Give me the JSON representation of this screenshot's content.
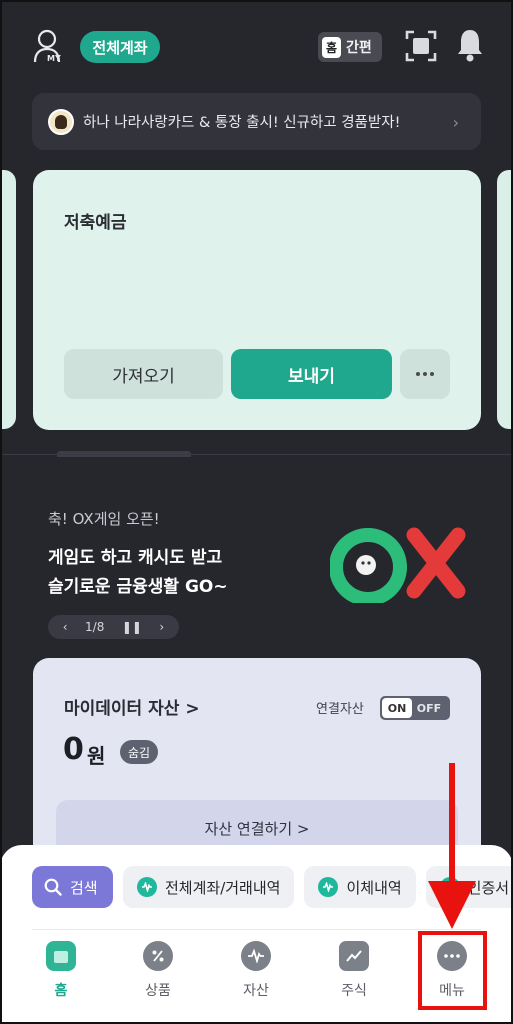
{
  "header": {
    "my_label": "MY",
    "all_accounts": "전체계좌",
    "easy_home_chip": "홈",
    "easy_label": "간편"
  },
  "banner": {
    "text": "하나 나라사랑카드 & 통장 출시! 신규하고 경품받자!"
  },
  "account_card": {
    "title": "저축예금",
    "get_label": "가져오기",
    "send_label": "보내기"
  },
  "promo": {
    "subtitle": "축! OX게임 오픈!",
    "line1": "게임도 하고 캐시도 받고",
    "line2": "슬기로운 금융생활 GO~",
    "page": "1/8"
  },
  "mydata": {
    "title": "마이데이터 자산 >",
    "linked_label": "연결자산",
    "toggle_on": "ON",
    "toggle_off": "OFF",
    "amount": "0",
    "unit": "원",
    "hide_label": "숨김",
    "connect_label": "자산 연결하기 >"
  },
  "quick_chips": [
    {
      "label": "검색"
    },
    {
      "label": "전체계좌/거래내역"
    },
    {
      "label": "이체내역"
    },
    {
      "label": "인증서"
    }
  ],
  "tabs": [
    {
      "label": "홈"
    },
    {
      "label": "상품"
    },
    {
      "label": "자산"
    },
    {
      "label": "주식"
    },
    {
      "label": "메뉴"
    }
  ],
  "colors": {
    "background": "#26262d",
    "accent": "#1fa88e",
    "annotation_red": "#e8120f"
  }
}
